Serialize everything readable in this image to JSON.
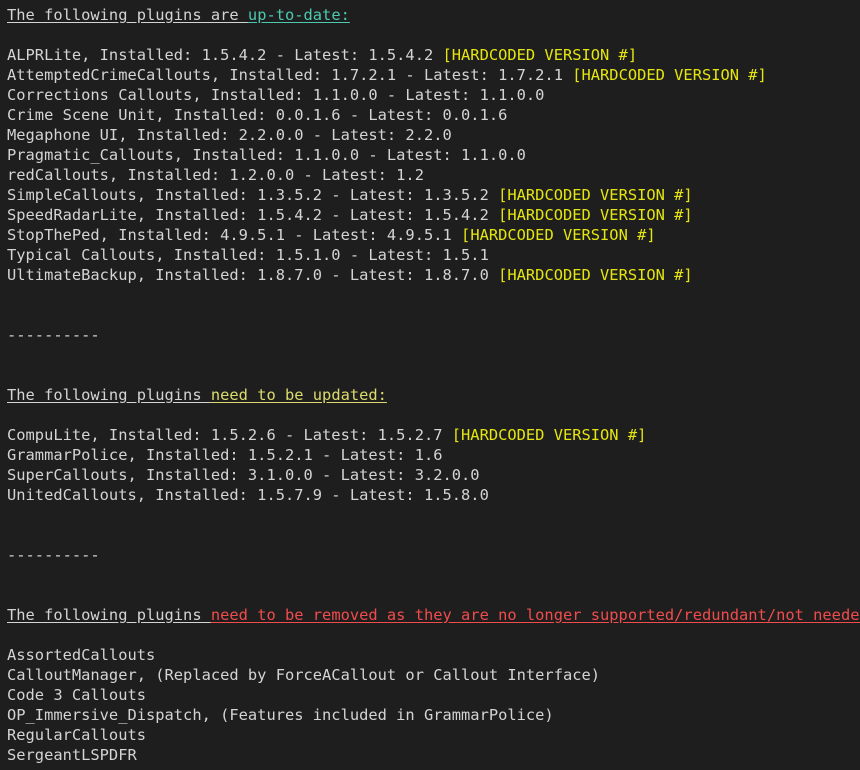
{
  "colors": {
    "background": "#1e1e1e",
    "text": "#d4d4d4",
    "uptodate_heading": "#4ec9b0",
    "update_heading": "#dcdc6c",
    "remove_heading": "#f14c4c",
    "hardcoded_tag": "#e5e510"
  },
  "sections": {
    "uptodate": {
      "heading_prefix": "The following plugins are ",
      "heading_highlight": "up-to-date:",
      "items": [
        {
          "text": "ALPRLite, Installed: 1.5.4.2 - Latest: 1.5.4.2 ",
          "tag": "[HARDCODED VERSION #]"
        },
        {
          "text": "AttemptedCrimeCallouts, Installed: 1.7.2.1 - Latest: 1.7.2.1 ",
          "tag": "[HARDCODED VERSION #]"
        },
        {
          "text": "Corrections Callouts, Installed: 1.1.0.0 - Latest: 1.1.0.0",
          "tag": ""
        },
        {
          "text": "Crime Scene Unit, Installed: 0.0.1.6 - Latest: 0.0.1.6",
          "tag": ""
        },
        {
          "text": "Megaphone UI, Installed: 2.2.0.0 - Latest: 2.2.0",
          "tag": ""
        },
        {
          "text": "Pragmatic_Callouts, Installed: 1.1.0.0 - Latest: 1.1.0.0",
          "tag": ""
        },
        {
          "text": "redCallouts, Installed: 1.2.0.0 - Latest: 1.2",
          "tag": ""
        },
        {
          "text": "SimpleCallouts, Installed: 1.3.5.2 - Latest: 1.3.5.2 ",
          "tag": "[HARDCODED VERSION #]"
        },
        {
          "text": "SpeedRadarLite, Installed: 1.5.4.2 - Latest: 1.5.4.2 ",
          "tag": "[HARDCODED VERSION #]"
        },
        {
          "text": "StopThePed, Installed: 4.9.5.1 - Latest: 4.9.5.1 ",
          "tag": "[HARDCODED VERSION #]"
        },
        {
          "text": "Typical Callouts, Installed: 1.5.1.0 - Latest: 1.5.1",
          "tag": ""
        },
        {
          "text": "UltimateBackup, Installed: 1.8.7.0 - Latest: 1.8.7.0 ",
          "tag": "[HARDCODED VERSION #]"
        }
      ]
    },
    "separator1": "----------",
    "update": {
      "heading_prefix": "The following plugins ",
      "heading_highlight": "need to be updated:",
      "items": [
        {
          "text": "CompuLite, Installed: 1.5.2.6 - Latest: 1.5.2.7 ",
          "tag": "[HARDCODED VERSION #]"
        },
        {
          "text": "GrammarPolice, Installed: 1.5.2.1 - Latest: 1.6",
          "tag": ""
        },
        {
          "text": "SuperCallouts, Installed: 3.1.0.0 - Latest: 3.2.0.0",
          "tag": ""
        },
        {
          "text": "UnitedCallouts, Installed: 1.5.7.9 - Latest: 1.5.8.0",
          "tag": ""
        }
      ]
    },
    "separator2": "----------",
    "remove": {
      "heading_prefix": "The following plugins ",
      "heading_highlight": "need to be removed as they are no longer supported/redundant/not needed:",
      "items": [
        {
          "text": "AssortedCallouts",
          "tag": ""
        },
        {
          "text": "CalloutManager, (Replaced by ForceACallout or Callout Interface)",
          "tag": ""
        },
        {
          "text": "Code 3 Callouts",
          "tag": ""
        },
        {
          "text": "OP_Immersive_Dispatch, (Features included in GrammarPolice)",
          "tag": ""
        },
        {
          "text": "RegularCallouts",
          "tag": ""
        },
        {
          "text": "SergeantLSPDFR",
          "tag": ""
        }
      ]
    }
  }
}
